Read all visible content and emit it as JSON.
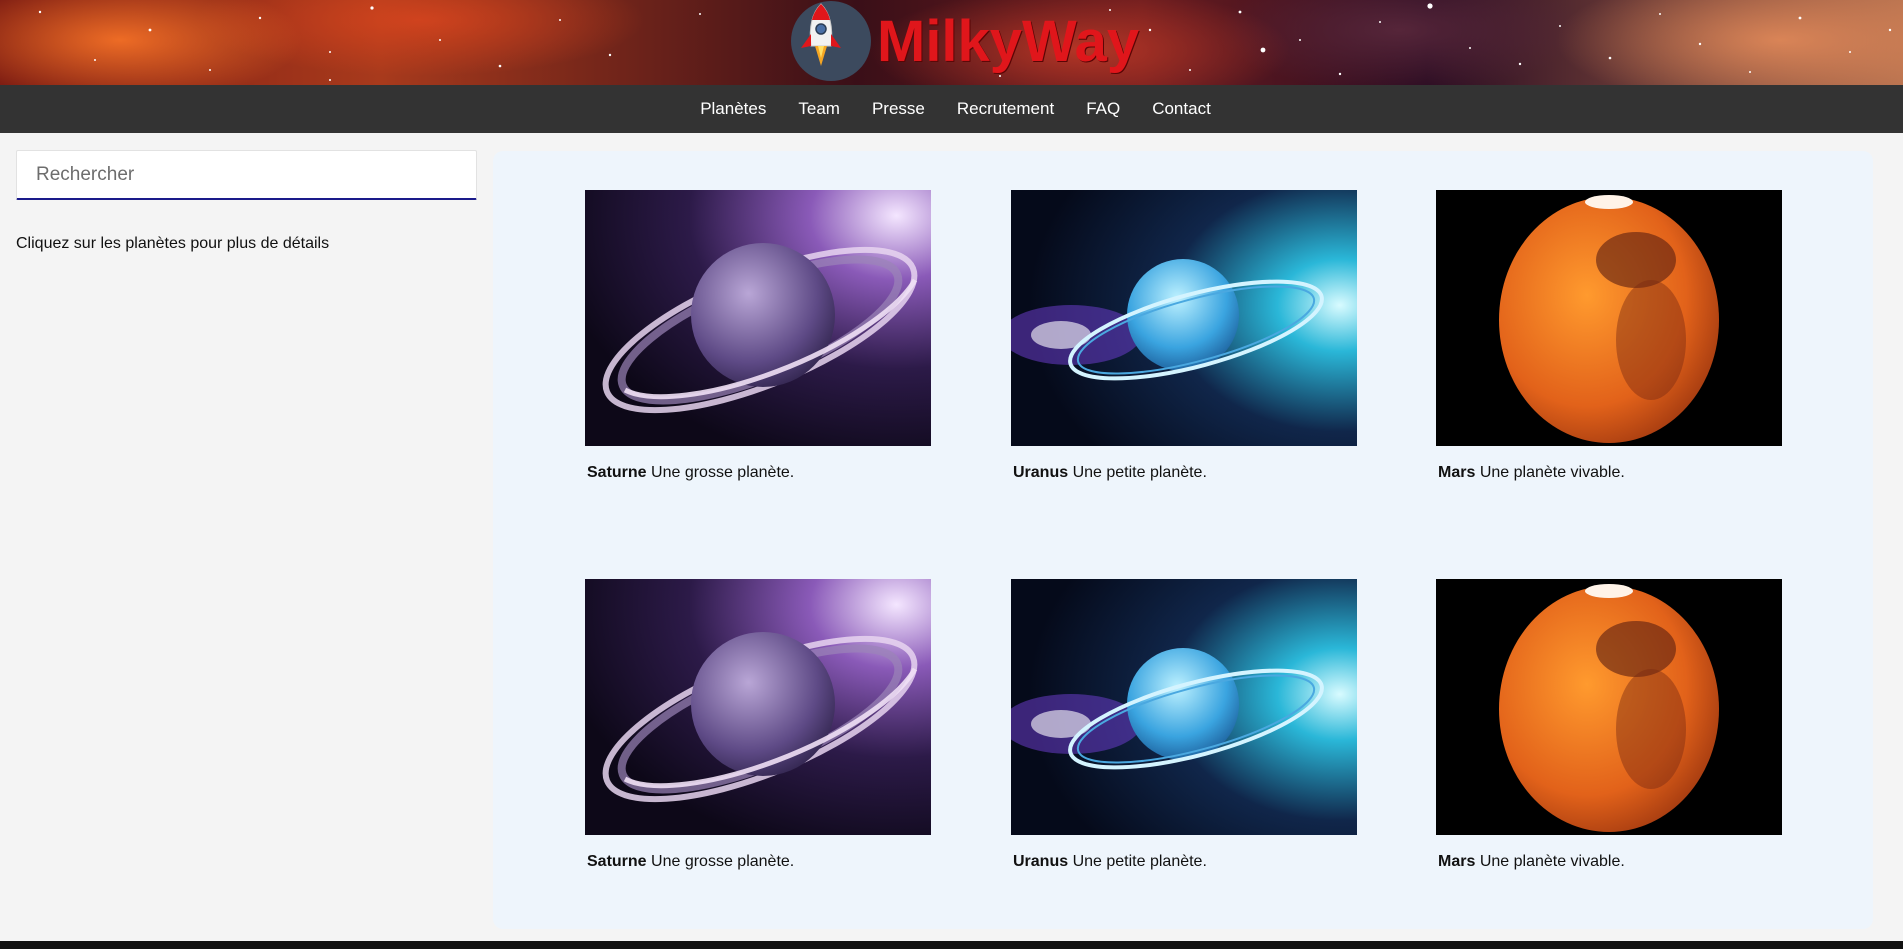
{
  "header": {
    "brand_name": "MilkyWay",
    "logo_icon": "rocket-icon"
  },
  "nav": {
    "items": [
      {
        "label": "Planètes"
      },
      {
        "label": "Team"
      },
      {
        "label": "Presse"
      },
      {
        "label": "Recrutement"
      },
      {
        "label": "FAQ"
      },
      {
        "label": "Contact"
      }
    ]
  },
  "sidebar": {
    "search_placeholder": "Rechercher",
    "search_value": "",
    "hint": "Cliquez sur les planètes pour plus de détails"
  },
  "planets": [
    {
      "name": "Saturne",
      "description": "Une grosse planète."
    },
    {
      "name": "Uranus",
      "description": "Une petite planète."
    },
    {
      "name": "Mars",
      "description": "Une planète vivable."
    },
    {
      "name": "Saturne",
      "description": "Une grosse planète."
    },
    {
      "name": "Uranus",
      "description": "Une petite planète."
    },
    {
      "name": "Mars",
      "description": "Une planète vivable."
    }
  ],
  "colors": {
    "brand": "#e0161b",
    "nav_background": "#333333",
    "search_underline": "#1a1a8a",
    "panel_background": "#eef5fc"
  }
}
